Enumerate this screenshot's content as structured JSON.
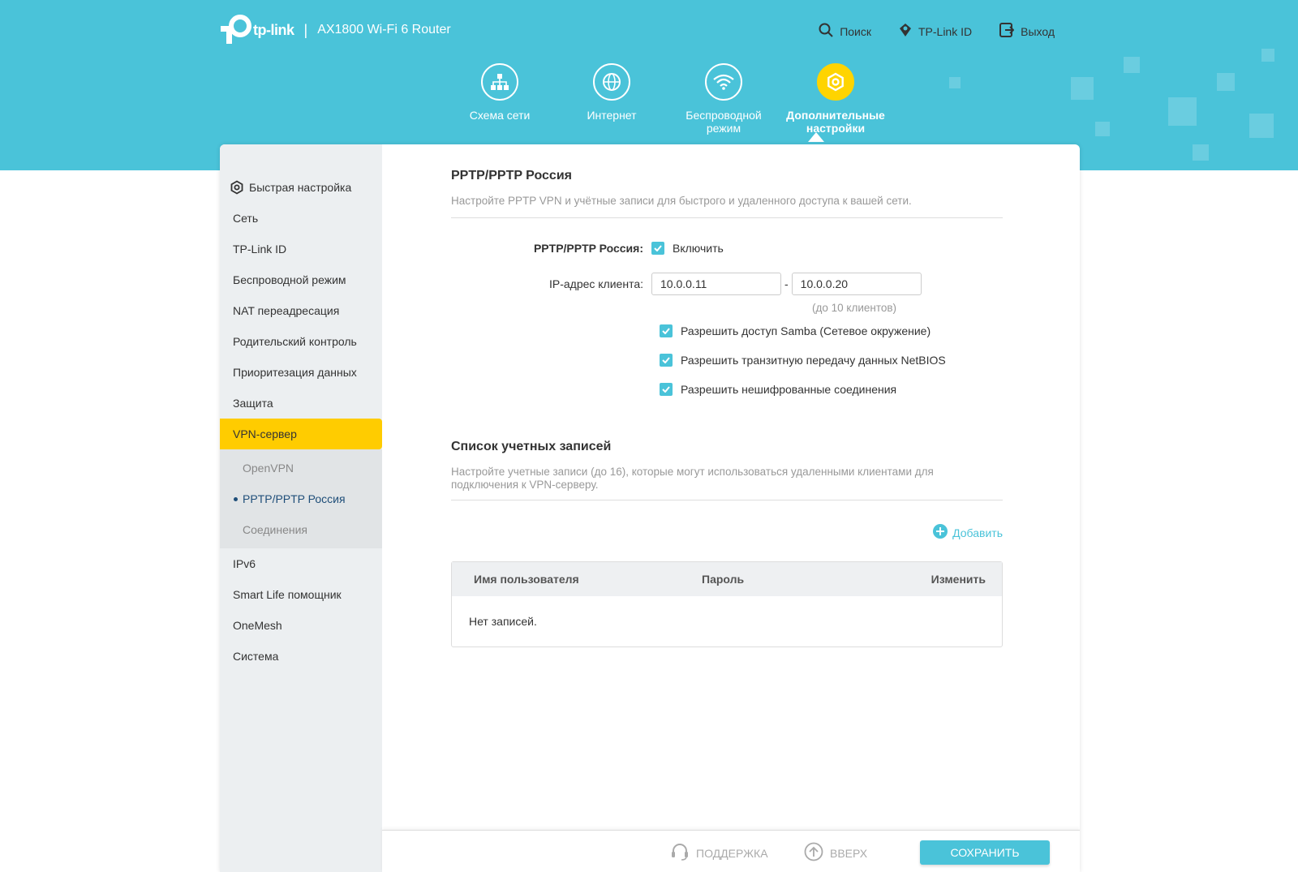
{
  "brand": {
    "logo_text": "tp-link",
    "separator": "|",
    "model": "AX1800 Wi-Fi 6 Router"
  },
  "top_links": {
    "search": "Поиск",
    "tplink_id": "TP-Link ID",
    "logout": "Выход"
  },
  "main_nav": [
    {
      "label": "Схема сети",
      "icon": "network-map-icon"
    },
    {
      "label": "Интернет",
      "icon": "globe-icon"
    },
    {
      "label": "Беспроводной режим",
      "icon": "wifi-icon"
    },
    {
      "label": "Дополнительные настройки",
      "icon": "gear-icon",
      "active": true
    }
  ],
  "sidebar": {
    "items": [
      {
        "label": "Быстрая настройка"
      },
      {
        "label": "Сеть"
      },
      {
        "label": "TP-Link ID"
      },
      {
        "label": "Беспроводной режим"
      },
      {
        "label": "NAT переадресация"
      },
      {
        "label": "Родительский контроль"
      },
      {
        "label": "Приоритезация данных"
      },
      {
        "label": "Защита"
      },
      {
        "label": "VPN-сервер"
      },
      {
        "label": "IPv6"
      },
      {
        "label": "Smart Life помощник"
      },
      {
        "label": "OneMesh"
      },
      {
        "label": "Система"
      }
    ],
    "vpn_sub": [
      {
        "label": "OpenVPN"
      },
      {
        "label": "PPTP/PPTP Россия"
      },
      {
        "label": "Соединения"
      }
    ]
  },
  "pptp": {
    "title": "PPTP/PPTP Россия",
    "desc": "Настройте PPTP VPN и учётные записи для быстрого и удаленного доступа к вашей сети.",
    "enable_label": "PPTP/PPTP Россия:",
    "enable_text": "Включить",
    "ip_label": "IP-адрес клиента:",
    "ip_from": "10.0.0.11",
    "ip_sep": "-",
    "ip_to": "10.0.0.20",
    "ip_hint": "(до 10 клиентов)",
    "samba": "Разрешить доступ Samba (Сетевое окружение)",
    "netbios": "Разрешить транзитную передачу данных NetBIOS",
    "unencrypted": "Разрешить нешифрованные соединения"
  },
  "accounts": {
    "title": "Список учетных записей",
    "desc": "Настройте учетные записи (до 16), которые могут использоваться удаленными клиентами для подключения к VPN-серверу.",
    "add": "Добавить",
    "col_user": "Имя пользователя",
    "col_pass": "Пароль",
    "col_edit": "Изменить",
    "empty": "Нет записей."
  },
  "footer": {
    "support": "ПОДДЕРЖКА",
    "up": "ВВЕРХ",
    "save": "СОХРАНИТЬ"
  },
  "colors": {
    "accent": "#4ac3d9",
    "active": "#ffcc00"
  }
}
